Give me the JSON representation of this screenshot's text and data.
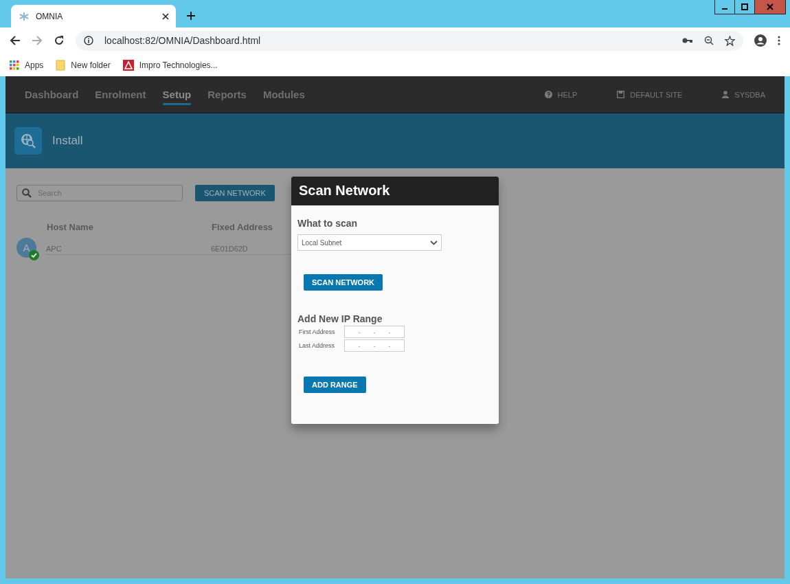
{
  "browser": {
    "tab_title": "OMNIA",
    "url": "localhost:82/OMNIA/Dashboard.html",
    "bookmarks": [
      {
        "kind": "apps",
        "label": "Apps"
      },
      {
        "kind": "folder",
        "label": "New folder"
      },
      {
        "kind": "logo",
        "label": "Impro Technologies..."
      }
    ]
  },
  "nav": {
    "items": [
      {
        "label": "Dashboard",
        "selected": false
      },
      {
        "label": "Enrolment",
        "selected": false
      },
      {
        "label": "Setup",
        "selected": true
      },
      {
        "label": "Reports",
        "selected": false
      },
      {
        "label": "Modules",
        "selected": false
      }
    ],
    "help": "HELP",
    "site": "DEFAULT SITE",
    "user": "SYSDBA"
  },
  "banner": {
    "title": "Install"
  },
  "search": {
    "placeholder": "Search"
  },
  "scan_button": "SCAN NETWORK",
  "table": {
    "columns": [
      "Host Name",
      "Fixed Address"
    ],
    "rows": [
      {
        "avatar": "A",
        "online": true,
        "host": "APC",
        "address": "6E01D62D"
      }
    ]
  },
  "dialog": {
    "title": "Scan Network",
    "what_label": "What to scan",
    "scan_type": "Local Subnet",
    "scan_button": "SCAN NETWORK",
    "range_title": "Add New IP Range",
    "fields": [
      {
        "label": "First Address",
        "separators": [
          "-",
          "-",
          "-"
        ]
      },
      {
        "label": "Last Address",
        "separators": [
          "-",
          "-",
          "-"
        ]
      }
    ],
    "add_button": "ADD RANGE"
  }
}
